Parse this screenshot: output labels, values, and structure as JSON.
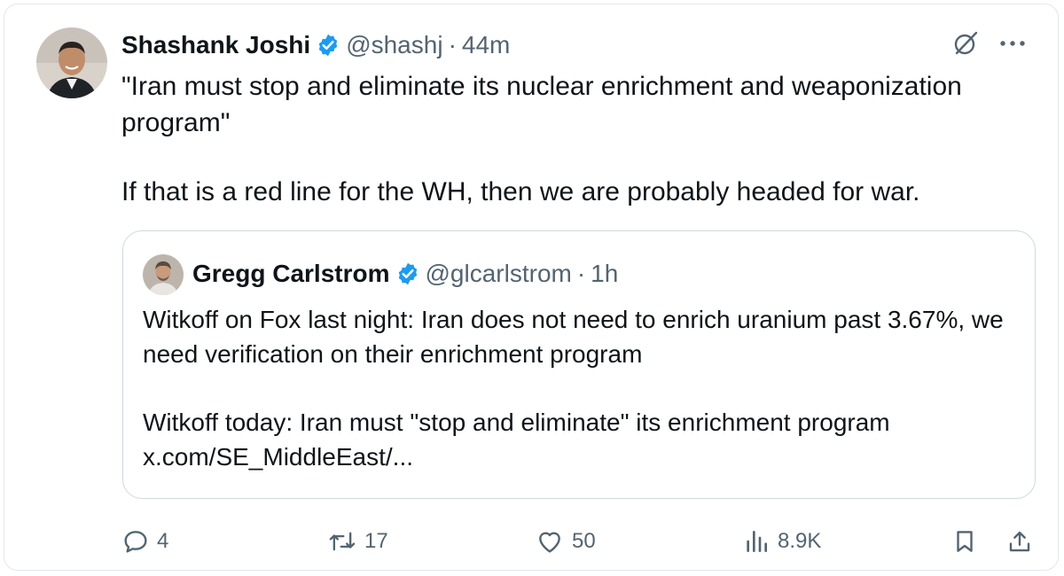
{
  "tweet": {
    "author_name": "Shashank Joshi",
    "author_handle": "@shashj",
    "separator": "·",
    "time": "44m",
    "text_line1": "\"Iran must stop and eliminate its nuclear enrichment and weaponization program\"",
    "text_line2": "If that is a red line for the WH, then we are probably headed for war."
  },
  "quote": {
    "author_name": "Gregg Carlstrom",
    "author_handle": "@glcarlstrom",
    "separator": "·",
    "time": "1h",
    "text_line1": "Witkoff on Fox last night: Iran does not need to enrich uranium past 3.67%, we need verification on their enrichment program",
    "text_line2": "Witkoff today: Iran must \"stop and eliminate\" its enrichment program",
    "link": "x.com/SE_MiddleEast/..."
  },
  "actions": {
    "replies": "4",
    "reposts": "17",
    "likes": "50",
    "views": "8.9K"
  },
  "colors": {
    "verified": "#1d9bf0",
    "secondary_text": "#536471",
    "border": "#cfd9de"
  },
  "icons": [
    "grok-icon",
    "more-icon",
    "reply-icon",
    "repost-icon",
    "like-icon",
    "views-icon",
    "bookmark-icon",
    "share-icon",
    "verified-badge-icon"
  ]
}
